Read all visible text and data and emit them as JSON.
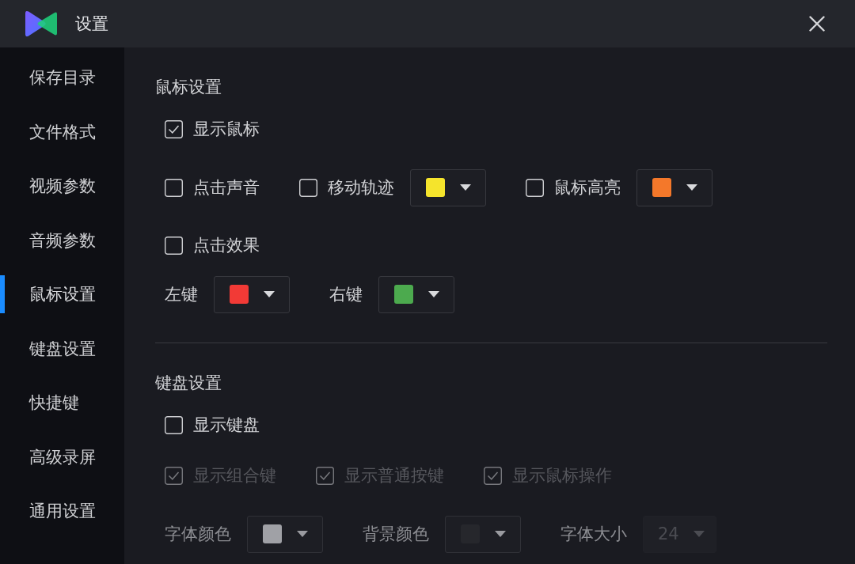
{
  "window": {
    "title": "设置"
  },
  "sidebar": {
    "items": [
      {
        "label": "保存目录",
        "selected": false
      },
      {
        "label": "文件格式",
        "selected": false
      },
      {
        "label": "视频参数",
        "selected": false
      },
      {
        "label": "音频参数",
        "selected": false
      },
      {
        "label": "鼠标设置",
        "selected": true
      },
      {
        "label": "键盘设置",
        "selected": false
      },
      {
        "label": "快捷键",
        "selected": false
      },
      {
        "label": "高级录屏",
        "selected": false
      },
      {
        "label": "通用设置",
        "selected": false
      }
    ]
  },
  "sections": [
    {
      "heading": "鼠标设置",
      "rows": [
        {
          "items": [
            {
              "kind": "checkbox",
              "label": "显示鼠标",
              "checked": true,
              "disabled": false
            }
          ]
        },
        {
          "items": [
            {
              "kind": "checkbox",
              "label": "点击声音",
              "checked": false,
              "disabled": false
            },
            {
              "kind": "checkbox",
              "label": "移动轨迹",
              "checked": false,
              "disabled": false
            },
            {
              "kind": "color_picker",
              "color": "#f5e42c",
              "disabled": false
            },
            {
              "kind": "checkbox",
              "label": "鼠标高亮",
              "checked": false,
              "disabled": false
            },
            {
              "kind": "color_picker",
              "color": "#f4782a",
              "disabled": false
            }
          ]
        },
        {
          "items": [
            {
              "kind": "checkbox",
              "label": "点击效果",
              "checked": false,
              "disabled": false
            }
          ]
        },
        {
          "items": [
            {
              "kind": "label",
              "label": "左键",
              "disabled": false
            },
            {
              "kind": "color_picker",
              "color": "#f23a36",
              "disabled": false
            },
            {
              "kind": "label",
              "label": "右键",
              "disabled": false
            },
            {
              "kind": "color_picker",
              "color": "#4caa4e",
              "disabled": false
            }
          ]
        }
      ]
    },
    {
      "heading": "键盘设置",
      "rows": [
        {
          "items": [
            {
              "kind": "checkbox",
              "label": "显示键盘",
              "checked": false,
              "disabled": false
            }
          ]
        },
        {
          "items": [
            {
              "kind": "checkbox",
              "label": "显示组合键",
              "checked": true,
              "disabled": true
            },
            {
              "kind": "checkbox",
              "label": "显示普通按键",
              "checked": true,
              "disabled": true
            },
            {
              "kind": "checkbox",
              "label": "显示鼠标操作",
              "checked": true,
              "disabled": true
            }
          ]
        },
        {
          "items": [
            {
              "kind": "label",
              "label": "字体颜色",
              "disabled": true
            },
            {
              "kind": "color_picker",
              "color": "#a0a1a6",
              "disabled": true
            },
            {
              "kind": "label",
              "label": "背景颜色",
              "disabled": true
            },
            {
              "kind": "color_picker",
              "color": "#26272c",
              "disabled": true
            },
            {
              "kind": "label",
              "label": "字体大小",
              "disabled": true
            },
            {
              "kind": "select",
              "value": "24",
              "disabled": true
            }
          ]
        }
      ]
    }
  ]
}
